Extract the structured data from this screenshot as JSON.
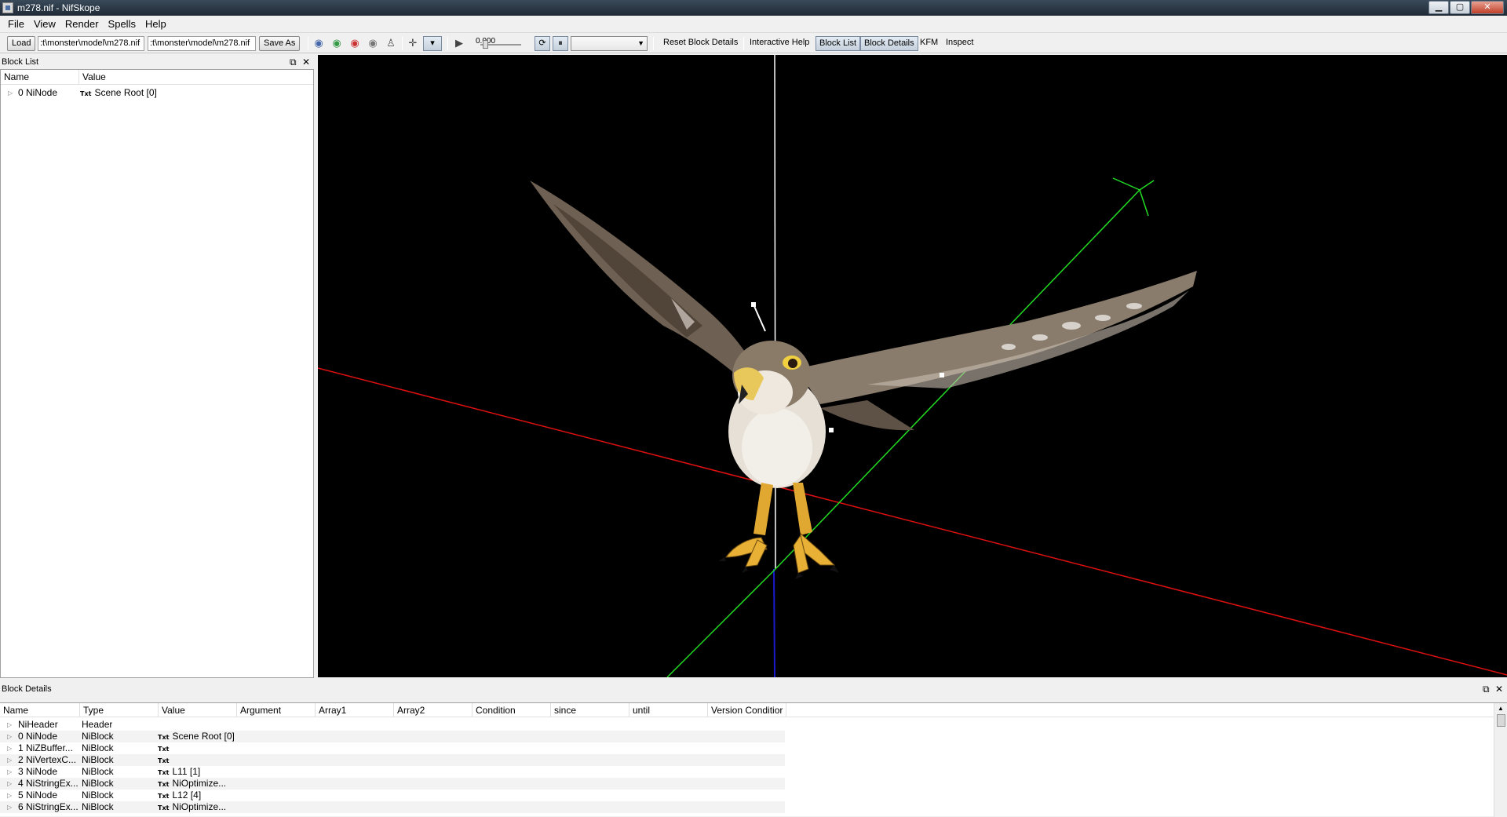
{
  "window": {
    "title": "m278.nif - NifSkope",
    "minimize": "▁",
    "maximize": "▢",
    "close": "✕"
  },
  "menu": [
    "File",
    "View",
    "Render",
    "Spells",
    "Help"
  ],
  "toolbar": {
    "load_label": "Load",
    "load_path": ":t\\monster\\model\\m278.nif",
    "save_path": ":t\\monster\\model\\m278.nif",
    "save_as_label": "Save As",
    "time_value": "0.000",
    "reset_block_details": "Reset Block Details",
    "interactive_help": "Interactive Help",
    "block_list": "Block List",
    "block_details": "Block Details",
    "kfm": "KFM",
    "inspect": "Inspect"
  },
  "block_list": {
    "title": "Block List",
    "columns": [
      "Name",
      "Value"
    ],
    "rows": [
      {
        "name": "0 NiNode",
        "value": "Scene Root [0]"
      }
    ]
  },
  "block_details": {
    "title": "Block Details",
    "columns": [
      "Name",
      "Type",
      "Value",
      "Argument",
      "Array1",
      "Array2",
      "Condition",
      "since",
      "until",
      "Version Conditior"
    ],
    "rows": [
      {
        "name": "NiHeader",
        "type": "Header",
        "value": "",
        "txt": false
      },
      {
        "name": "0 NiNode",
        "type": "NiBlock",
        "value": "Scene Root [0]",
        "txt": true
      },
      {
        "name": "1 NiZBuffer...",
        "type": "NiBlock",
        "value": "",
        "txt": true
      },
      {
        "name": "2 NiVertexC...",
        "type": "NiBlock",
        "value": "",
        "txt": true
      },
      {
        "name": "3 NiNode",
        "type": "NiBlock",
        "value": "L11 [1]",
        "txt": true
      },
      {
        "name": "4 NiStringEx...",
        "type": "NiBlock",
        "value": "NiOptimize...",
        "txt": true
      },
      {
        "name": "5 NiNode",
        "type": "NiBlock",
        "value": "L12 [4]",
        "txt": true
      },
      {
        "name": "6 NiStringEx...",
        "type": "NiBlock",
        "value": "NiOptimize...",
        "txt": true
      }
    ]
  },
  "colors": {
    "x_axis": "#e01010",
    "y_axis": "#22dd22",
    "z_axis": "#1a1acc",
    "viewport_bg": "#000000"
  }
}
